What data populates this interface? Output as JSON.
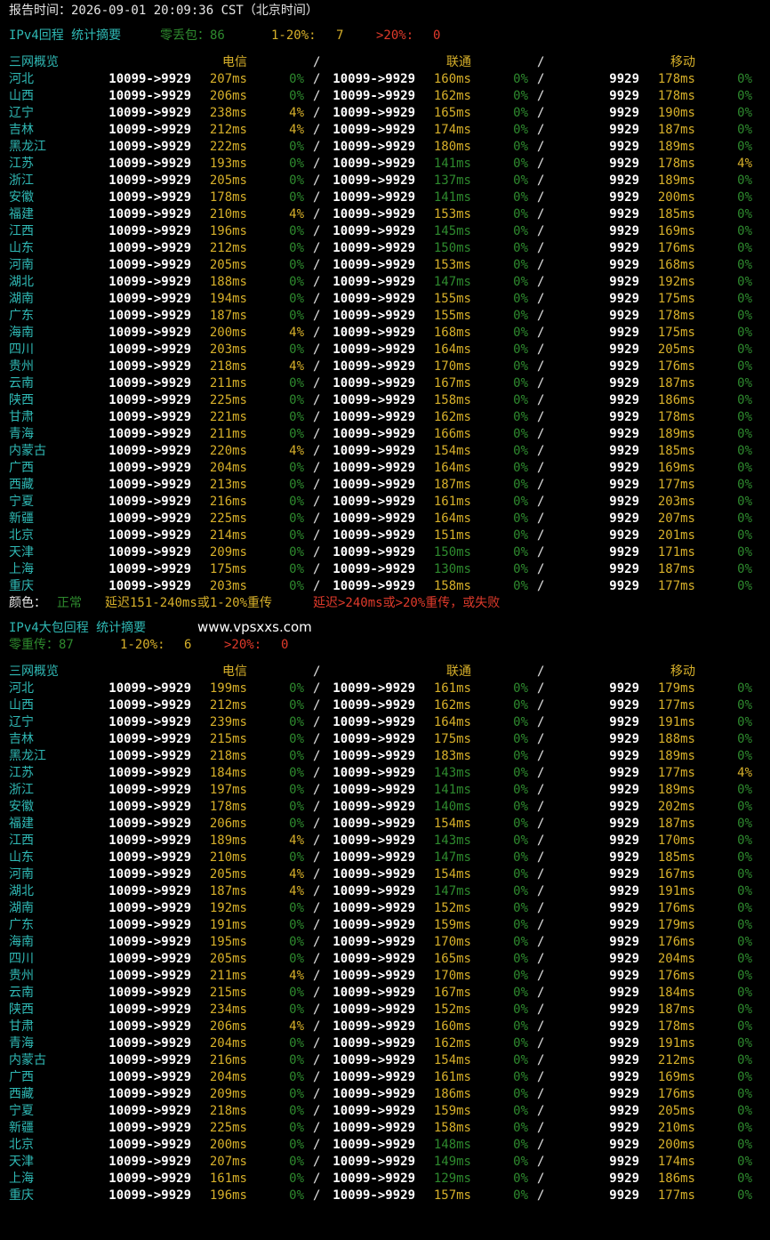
{
  "colors": {
    "text": "#e6e6e6",
    "cyan": "#2fb9b5",
    "normal_green": "#2e8a2e",
    "warn_yellow": "#d7b02a",
    "bad_red": "#e03a2b"
  },
  "report_time": "报告时间：2026-09-01 20:09:36 CST（北京时间）",
  "legend": {
    "label": "颜色：",
    "normal": "正常",
    "warn": "延迟151-240ms或1-20%重传",
    "bad": "延迟>240ms或>20%重传，或失败"
  },
  "watermark": "www.vpsxxs.com",
  "sections": [
    {
      "title": "IPv4回程 统计摘要",
      "summary": {
        "zero": "零丢包：86",
        "mid_label": "1-20%:",
        "mid_value": "7",
        "high_label": ">20%:",
        "high_value": "0"
      },
      "header": {
        "name": "三网概览",
        "telecom": "电信",
        "unicom": "联通",
        "mobile": "移动",
        "sep": "/"
      },
      "rows": [
        {
          "name": "河北",
          "t_route": "10099->9929",
          "t_ms": "207ms",
          "t_loss": "0%",
          "u_route": "10099->9929",
          "u_ms": "160ms",
          "u_loss": "0%",
          "m_route": "9929",
          "m_ms": "178ms",
          "m_loss": "0%"
        },
        {
          "name": "山西",
          "t_route": "10099->9929",
          "t_ms": "206ms",
          "t_loss": "0%",
          "u_route": "10099->9929",
          "u_ms": "162ms",
          "u_loss": "0%",
          "m_route": "9929",
          "m_ms": "178ms",
          "m_loss": "0%"
        },
        {
          "name": "辽宁",
          "t_route": "10099->9929",
          "t_ms": "238ms",
          "t_loss": "4%",
          "u_route": "10099->9929",
          "u_ms": "165ms",
          "u_loss": "0%",
          "m_route": "9929",
          "m_ms": "190ms",
          "m_loss": "0%"
        },
        {
          "name": "吉林",
          "t_route": "10099->9929",
          "t_ms": "212ms",
          "t_loss": "4%",
          "u_route": "10099->9929",
          "u_ms": "174ms",
          "u_loss": "0%",
          "m_route": "9929",
          "m_ms": "187ms",
          "m_loss": "0%"
        },
        {
          "name": "黑龙江",
          "t_route": "10099->9929",
          "t_ms": "222ms",
          "t_loss": "0%",
          "u_route": "10099->9929",
          "u_ms": "180ms",
          "u_loss": "0%",
          "m_route": "9929",
          "m_ms": "189ms",
          "m_loss": "0%"
        },
        {
          "name": "江苏",
          "t_route": "10099->9929",
          "t_ms": "193ms",
          "t_loss": "0%",
          "u_route": "10099->9929",
          "u_ms": "141ms",
          "u_loss": "0%",
          "m_route": "9929",
          "m_ms": "178ms",
          "m_loss": "4%"
        },
        {
          "name": "浙江",
          "t_route": "10099->9929",
          "t_ms": "205ms",
          "t_loss": "0%",
          "u_route": "10099->9929",
          "u_ms": "137ms",
          "u_loss": "0%",
          "m_route": "9929",
          "m_ms": "189ms",
          "m_loss": "0%"
        },
        {
          "name": "安徽",
          "t_route": "10099->9929",
          "t_ms": "178ms",
          "t_loss": "0%",
          "u_route": "10099->9929",
          "u_ms": "141ms",
          "u_loss": "0%",
          "m_route": "9929",
          "m_ms": "200ms",
          "m_loss": "0%"
        },
        {
          "name": "福建",
          "t_route": "10099->9929",
          "t_ms": "210ms",
          "t_loss": "4%",
          "u_route": "10099->9929",
          "u_ms": "153ms",
          "u_loss": "0%",
          "m_route": "9929",
          "m_ms": "185ms",
          "m_loss": "0%"
        },
        {
          "name": "江西",
          "t_route": "10099->9929",
          "t_ms": "196ms",
          "t_loss": "0%",
          "u_route": "10099->9929",
          "u_ms": "145ms",
          "u_loss": "0%",
          "m_route": "9929",
          "m_ms": "169ms",
          "m_loss": "0%"
        },
        {
          "name": "山东",
          "t_route": "10099->9929",
          "t_ms": "212ms",
          "t_loss": "0%",
          "u_route": "10099->9929",
          "u_ms": "150ms",
          "u_loss": "0%",
          "m_route": "9929",
          "m_ms": "176ms",
          "m_loss": "0%"
        },
        {
          "name": "河南",
          "t_route": "10099->9929",
          "t_ms": "205ms",
          "t_loss": "0%",
          "u_route": "10099->9929",
          "u_ms": "153ms",
          "u_loss": "0%",
          "m_route": "9929",
          "m_ms": "168ms",
          "m_loss": "0%"
        },
        {
          "name": "湖北",
          "t_route": "10099->9929",
          "t_ms": "188ms",
          "t_loss": "0%",
          "u_route": "10099->9929",
          "u_ms": "147ms",
          "u_loss": "0%",
          "m_route": "9929",
          "m_ms": "192ms",
          "m_loss": "0%"
        },
        {
          "name": "湖南",
          "t_route": "10099->9929",
          "t_ms": "194ms",
          "t_loss": "0%",
          "u_route": "10099->9929",
          "u_ms": "155ms",
          "u_loss": "0%",
          "m_route": "9929",
          "m_ms": "175ms",
          "m_loss": "0%"
        },
        {
          "name": "广东",
          "t_route": "10099->9929",
          "t_ms": "187ms",
          "t_loss": "0%",
          "u_route": "10099->9929",
          "u_ms": "155ms",
          "u_loss": "0%",
          "m_route": "9929",
          "m_ms": "178ms",
          "m_loss": "0%"
        },
        {
          "name": "海南",
          "t_route": "10099->9929",
          "t_ms": "200ms",
          "t_loss": "4%",
          "u_route": "10099->9929",
          "u_ms": "168ms",
          "u_loss": "0%",
          "m_route": "9929",
          "m_ms": "175ms",
          "m_loss": "0%"
        },
        {
          "name": "四川",
          "t_route": "10099->9929",
          "t_ms": "203ms",
          "t_loss": "0%",
          "u_route": "10099->9929",
          "u_ms": "164ms",
          "u_loss": "0%",
          "m_route": "9929",
          "m_ms": "205ms",
          "m_loss": "0%"
        },
        {
          "name": "贵州",
          "t_route": "10099->9929",
          "t_ms": "218ms",
          "t_loss": "4%",
          "u_route": "10099->9929",
          "u_ms": "170ms",
          "u_loss": "0%",
          "m_route": "9929",
          "m_ms": "176ms",
          "m_loss": "0%"
        },
        {
          "name": "云南",
          "t_route": "10099->9929",
          "t_ms": "211ms",
          "t_loss": "0%",
          "u_route": "10099->9929",
          "u_ms": "167ms",
          "u_loss": "0%",
          "m_route": "9929",
          "m_ms": "187ms",
          "m_loss": "0%"
        },
        {
          "name": "陕西",
          "t_route": "10099->9929",
          "t_ms": "225ms",
          "t_loss": "0%",
          "u_route": "10099->9929",
          "u_ms": "158ms",
          "u_loss": "0%",
          "m_route": "9929",
          "m_ms": "186ms",
          "m_loss": "0%"
        },
        {
          "name": "甘肃",
          "t_route": "10099->9929",
          "t_ms": "221ms",
          "t_loss": "0%",
          "u_route": "10099->9929",
          "u_ms": "162ms",
          "u_loss": "0%",
          "m_route": "9929",
          "m_ms": "178ms",
          "m_loss": "0%"
        },
        {
          "name": "青海",
          "t_route": "10099->9929",
          "t_ms": "211ms",
          "t_loss": "0%",
          "u_route": "10099->9929",
          "u_ms": "166ms",
          "u_loss": "0%",
          "m_route": "9929",
          "m_ms": "189ms",
          "m_loss": "0%"
        },
        {
          "name": "内蒙古",
          "t_route": "10099->9929",
          "t_ms": "220ms",
          "t_loss": "4%",
          "u_route": "10099->9929",
          "u_ms": "154ms",
          "u_loss": "0%",
          "m_route": "9929",
          "m_ms": "185ms",
          "m_loss": "0%"
        },
        {
          "name": "广西",
          "t_route": "10099->9929",
          "t_ms": "204ms",
          "t_loss": "0%",
          "u_route": "10099->9929",
          "u_ms": "164ms",
          "u_loss": "0%",
          "m_route": "9929",
          "m_ms": "169ms",
          "m_loss": "0%"
        },
        {
          "name": "西藏",
          "t_route": "10099->9929",
          "t_ms": "213ms",
          "t_loss": "0%",
          "u_route": "10099->9929",
          "u_ms": "187ms",
          "u_loss": "0%",
          "m_route": "9929",
          "m_ms": "177ms",
          "m_loss": "0%"
        },
        {
          "name": "宁夏",
          "t_route": "10099->9929",
          "t_ms": "216ms",
          "t_loss": "0%",
          "u_route": "10099->9929",
          "u_ms": "161ms",
          "u_loss": "0%",
          "m_route": "9929",
          "m_ms": "203ms",
          "m_loss": "0%"
        },
        {
          "name": "新疆",
          "t_route": "10099->9929",
          "t_ms": "225ms",
          "t_loss": "0%",
          "u_route": "10099->9929",
          "u_ms": "164ms",
          "u_loss": "0%",
          "m_route": "9929",
          "m_ms": "207ms",
          "m_loss": "0%"
        },
        {
          "name": "北京",
          "t_route": "10099->9929",
          "t_ms": "214ms",
          "t_loss": "0%",
          "u_route": "10099->9929",
          "u_ms": "151ms",
          "u_loss": "0%",
          "m_route": "9929",
          "m_ms": "201ms",
          "m_loss": "0%"
        },
        {
          "name": "天津",
          "t_route": "10099->9929",
          "t_ms": "209ms",
          "t_loss": "0%",
          "u_route": "10099->9929",
          "u_ms": "150ms",
          "u_loss": "0%",
          "m_route": "9929",
          "m_ms": "171ms",
          "m_loss": "0%"
        },
        {
          "name": "上海",
          "t_route": "10099->9929",
          "t_ms": "175ms",
          "t_loss": "0%",
          "u_route": "10099->9929",
          "u_ms": "130ms",
          "u_loss": "0%",
          "m_route": "9929",
          "m_ms": "187ms",
          "m_loss": "0%"
        },
        {
          "name": "重庆",
          "t_route": "10099->9929",
          "t_ms": "203ms",
          "t_loss": "0%",
          "u_route": "10099->9929",
          "u_ms": "158ms",
          "u_loss": "0%",
          "m_route": "9929",
          "m_ms": "177ms",
          "m_loss": "0%"
        }
      ]
    },
    {
      "title": "IPv4大包回程 统计摘要",
      "summary": {
        "zero": "零重传：87",
        "mid_label": "1-20%:",
        "mid_value": "6",
        "high_label": ">20%:",
        "high_value": "0"
      },
      "header": {
        "name": "三网概览",
        "telecom": "电信",
        "unicom": "联通",
        "mobile": "移动",
        "sep": "/"
      },
      "rows": [
        {
          "name": "河北",
          "t_route": "10099->9929",
          "t_ms": "199ms",
          "t_loss": "0%",
          "u_route": "10099->9929",
          "u_ms": "161ms",
          "u_loss": "0%",
          "m_route": "9929",
          "m_ms": "179ms",
          "m_loss": "0%"
        },
        {
          "name": "山西",
          "t_route": "10099->9929",
          "t_ms": "212ms",
          "t_loss": "0%",
          "u_route": "10099->9929",
          "u_ms": "162ms",
          "u_loss": "0%",
          "m_route": "9929",
          "m_ms": "177ms",
          "m_loss": "0%"
        },
        {
          "name": "辽宁",
          "t_route": "10099->9929",
          "t_ms": "239ms",
          "t_loss": "0%",
          "u_route": "10099->9929",
          "u_ms": "164ms",
          "u_loss": "0%",
          "m_route": "9929",
          "m_ms": "191ms",
          "m_loss": "0%"
        },
        {
          "name": "吉林",
          "t_route": "10099->9929",
          "t_ms": "215ms",
          "t_loss": "0%",
          "u_route": "10099->9929",
          "u_ms": "175ms",
          "u_loss": "0%",
          "m_route": "9929",
          "m_ms": "188ms",
          "m_loss": "0%"
        },
        {
          "name": "黑龙江",
          "t_route": "10099->9929",
          "t_ms": "218ms",
          "t_loss": "0%",
          "u_route": "10099->9929",
          "u_ms": "183ms",
          "u_loss": "0%",
          "m_route": "9929",
          "m_ms": "189ms",
          "m_loss": "0%"
        },
        {
          "name": "江苏",
          "t_route": "10099->9929",
          "t_ms": "184ms",
          "t_loss": "0%",
          "u_route": "10099->9929",
          "u_ms": "143ms",
          "u_loss": "0%",
          "m_route": "9929",
          "m_ms": "177ms",
          "m_loss": "4%"
        },
        {
          "name": "浙江",
          "t_route": "10099->9929",
          "t_ms": "197ms",
          "t_loss": "0%",
          "u_route": "10099->9929",
          "u_ms": "141ms",
          "u_loss": "0%",
          "m_route": "9929",
          "m_ms": "189ms",
          "m_loss": "0%"
        },
        {
          "name": "安徽",
          "t_route": "10099->9929",
          "t_ms": "178ms",
          "t_loss": "0%",
          "u_route": "10099->9929",
          "u_ms": "140ms",
          "u_loss": "0%",
          "m_route": "9929",
          "m_ms": "202ms",
          "m_loss": "0%"
        },
        {
          "name": "福建",
          "t_route": "10099->9929",
          "t_ms": "206ms",
          "t_loss": "0%",
          "u_route": "10099->9929",
          "u_ms": "154ms",
          "u_loss": "0%",
          "m_route": "9929",
          "m_ms": "187ms",
          "m_loss": "0%"
        },
        {
          "name": "江西",
          "t_route": "10099->9929",
          "t_ms": "189ms",
          "t_loss": "4%",
          "u_route": "10099->9929",
          "u_ms": "143ms",
          "u_loss": "0%",
          "m_route": "9929",
          "m_ms": "170ms",
          "m_loss": "0%"
        },
        {
          "name": "山东",
          "t_route": "10099->9929",
          "t_ms": "210ms",
          "t_loss": "0%",
          "u_route": "10099->9929",
          "u_ms": "147ms",
          "u_loss": "0%",
          "m_route": "9929",
          "m_ms": "185ms",
          "m_loss": "0%"
        },
        {
          "name": "河南",
          "t_route": "10099->9929",
          "t_ms": "205ms",
          "t_loss": "4%",
          "u_route": "10099->9929",
          "u_ms": "154ms",
          "u_loss": "0%",
          "m_route": "9929",
          "m_ms": "167ms",
          "m_loss": "0%"
        },
        {
          "name": "湖北",
          "t_route": "10099->9929",
          "t_ms": "187ms",
          "t_loss": "4%",
          "u_route": "10099->9929",
          "u_ms": "147ms",
          "u_loss": "0%",
          "m_route": "9929",
          "m_ms": "191ms",
          "m_loss": "0%"
        },
        {
          "name": "湖南",
          "t_route": "10099->9929",
          "t_ms": "192ms",
          "t_loss": "0%",
          "u_route": "10099->9929",
          "u_ms": "152ms",
          "u_loss": "0%",
          "m_route": "9929",
          "m_ms": "176ms",
          "m_loss": "0%"
        },
        {
          "name": "广东",
          "t_route": "10099->9929",
          "t_ms": "191ms",
          "t_loss": "0%",
          "u_route": "10099->9929",
          "u_ms": "159ms",
          "u_loss": "0%",
          "m_route": "9929",
          "m_ms": "179ms",
          "m_loss": "0%"
        },
        {
          "name": "海南",
          "t_route": "10099->9929",
          "t_ms": "195ms",
          "t_loss": "0%",
          "u_route": "10099->9929",
          "u_ms": "170ms",
          "u_loss": "0%",
          "m_route": "9929",
          "m_ms": "176ms",
          "m_loss": "0%"
        },
        {
          "name": "四川",
          "t_route": "10099->9929",
          "t_ms": "205ms",
          "t_loss": "0%",
          "u_route": "10099->9929",
          "u_ms": "165ms",
          "u_loss": "0%",
          "m_route": "9929",
          "m_ms": "204ms",
          "m_loss": "0%"
        },
        {
          "name": "贵州",
          "t_route": "10099->9929",
          "t_ms": "211ms",
          "t_loss": "4%",
          "u_route": "10099->9929",
          "u_ms": "170ms",
          "u_loss": "0%",
          "m_route": "9929",
          "m_ms": "176ms",
          "m_loss": "0%"
        },
        {
          "name": "云南",
          "t_route": "10099->9929",
          "t_ms": "215ms",
          "t_loss": "0%",
          "u_route": "10099->9929",
          "u_ms": "167ms",
          "u_loss": "0%",
          "m_route": "9929",
          "m_ms": "184ms",
          "m_loss": "0%"
        },
        {
          "name": "陕西",
          "t_route": "10099->9929",
          "t_ms": "234ms",
          "t_loss": "0%",
          "u_route": "10099->9929",
          "u_ms": "152ms",
          "u_loss": "0%",
          "m_route": "9929",
          "m_ms": "187ms",
          "m_loss": "0%"
        },
        {
          "name": "甘肃",
          "t_route": "10099->9929",
          "t_ms": "206ms",
          "t_loss": "4%",
          "u_route": "10099->9929",
          "u_ms": "160ms",
          "u_loss": "0%",
          "m_route": "9929",
          "m_ms": "178ms",
          "m_loss": "0%"
        },
        {
          "name": "青海",
          "t_route": "10099->9929",
          "t_ms": "204ms",
          "t_loss": "0%",
          "u_route": "10099->9929",
          "u_ms": "162ms",
          "u_loss": "0%",
          "m_route": "9929",
          "m_ms": "191ms",
          "m_loss": "0%"
        },
        {
          "name": "内蒙古",
          "t_route": "10099->9929",
          "t_ms": "216ms",
          "t_loss": "0%",
          "u_route": "10099->9929",
          "u_ms": "154ms",
          "u_loss": "0%",
          "m_route": "9929",
          "m_ms": "212ms",
          "m_loss": "0%"
        },
        {
          "name": "广西",
          "t_route": "10099->9929",
          "t_ms": "204ms",
          "t_loss": "0%",
          "u_route": "10099->9929",
          "u_ms": "161ms",
          "u_loss": "0%",
          "m_route": "9929",
          "m_ms": "169ms",
          "m_loss": "0%"
        },
        {
          "name": "西藏",
          "t_route": "10099->9929",
          "t_ms": "209ms",
          "t_loss": "0%",
          "u_route": "10099->9929",
          "u_ms": "186ms",
          "u_loss": "0%",
          "m_route": "9929",
          "m_ms": "176ms",
          "m_loss": "0%"
        },
        {
          "name": "宁夏",
          "t_route": "10099->9929",
          "t_ms": "218ms",
          "t_loss": "0%",
          "u_route": "10099->9929",
          "u_ms": "159ms",
          "u_loss": "0%",
          "m_route": "9929",
          "m_ms": "205ms",
          "m_loss": "0%"
        },
        {
          "name": "新疆",
          "t_route": "10099->9929",
          "t_ms": "225ms",
          "t_loss": "0%",
          "u_route": "10099->9929",
          "u_ms": "158ms",
          "u_loss": "0%",
          "m_route": "9929",
          "m_ms": "210ms",
          "m_loss": "0%"
        },
        {
          "name": "北京",
          "t_route": "10099->9929",
          "t_ms": "200ms",
          "t_loss": "0%",
          "u_route": "10099->9929",
          "u_ms": "148ms",
          "u_loss": "0%",
          "m_route": "9929",
          "m_ms": "200ms",
          "m_loss": "0%"
        },
        {
          "name": "天津",
          "t_route": "10099->9929",
          "t_ms": "207ms",
          "t_loss": "0%",
          "u_route": "10099->9929",
          "u_ms": "149ms",
          "u_loss": "0%",
          "m_route": "9929",
          "m_ms": "174ms",
          "m_loss": "0%"
        },
        {
          "name": "上海",
          "t_route": "10099->9929",
          "t_ms": "161ms",
          "t_loss": "0%",
          "u_route": "10099->9929",
          "u_ms": "129ms",
          "u_loss": "0%",
          "m_route": "9929",
          "m_ms": "186ms",
          "m_loss": "0%"
        },
        {
          "name": "重庆",
          "t_route": "10099->9929",
          "t_ms": "196ms",
          "t_loss": "0%",
          "u_route": "10099->9929",
          "u_ms": "157ms",
          "u_loss": "0%",
          "m_route": "9929",
          "m_ms": "177ms",
          "m_loss": "0%"
        }
      ]
    }
  ]
}
